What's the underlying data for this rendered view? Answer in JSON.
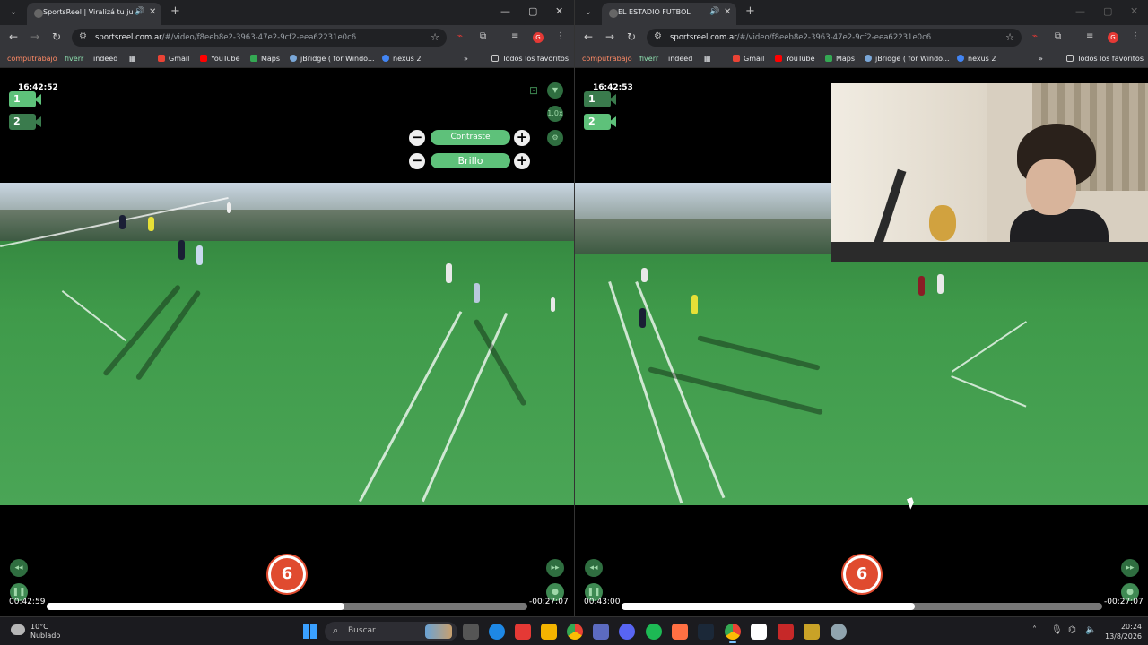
{
  "left_window": {
    "tab": {
      "title": "SportsReel | Viralizá tu juego",
      "audio_icon": "speaker-icon",
      "close": "✕"
    },
    "url": {
      "host": "sportsreel.com.ar",
      "path": "/#/video/f8eeb8e2-3963-47e2-9cf2-eea62231e0c6"
    },
    "bookmarks": [
      "computrabajo",
      "fiverr",
      "indeed",
      "Gmail",
      "YouTube",
      "Maps",
      "jBridge ( for Windo...",
      "nexus 2"
    ],
    "bookmarks_more": "»",
    "all_favorites": "Todos los favoritos",
    "clock": "16:42:52",
    "cam1": "1",
    "cam2": "2",
    "contrast_label": "Contraste",
    "brightness_label": "Brillo",
    "speed_label": "1.0x",
    "time_current": "00:42:59",
    "time_remaining": "-00:27:07",
    "progress": 0.62
  },
  "right_window": {
    "tab": {
      "title": "EL ESTADIO FUTBOL",
      "audio_icon": "speaker-icon",
      "close": "✕"
    },
    "url": {
      "host": "sportsreel.com.ar",
      "path": "/#/video/f8eeb8e2-3963-47e2-9cf2-eea62231e0c6"
    },
    "bookmarks": [
      "computrabajo",
      "fiverr",
      "indeed",
      "Gmail",
      "YouTube",
      "Maps",
      "jBridge ( for Windo...",
      "nexus 2"
    ],
    "bookmarks_more": "»",
    "all_favorites": "Todos los favoritos",
    "clock": "16:42:53",
    "cam1": "1",
    "cam2": "2",
    "time_current": "00:43:00",
    "time_remaining": "-00:27:07",
    "progress": 0.61
  },
  "taskbar": {
    "weather_temp": "10°C",
    "weather_desc": "Nublado",
    "search_placeholder": "Buscar",
    "time": "20:24",
    "date": "13/8/2026"
  },
  "colors": {
    "accent_green": "#5ec17a",
    "dark_green": "#2f6e40",
    "play_red": "#e04b2f",
    "browser_dark": "#202124",
    "browser_toolbar": "#35363a"
  }
}
